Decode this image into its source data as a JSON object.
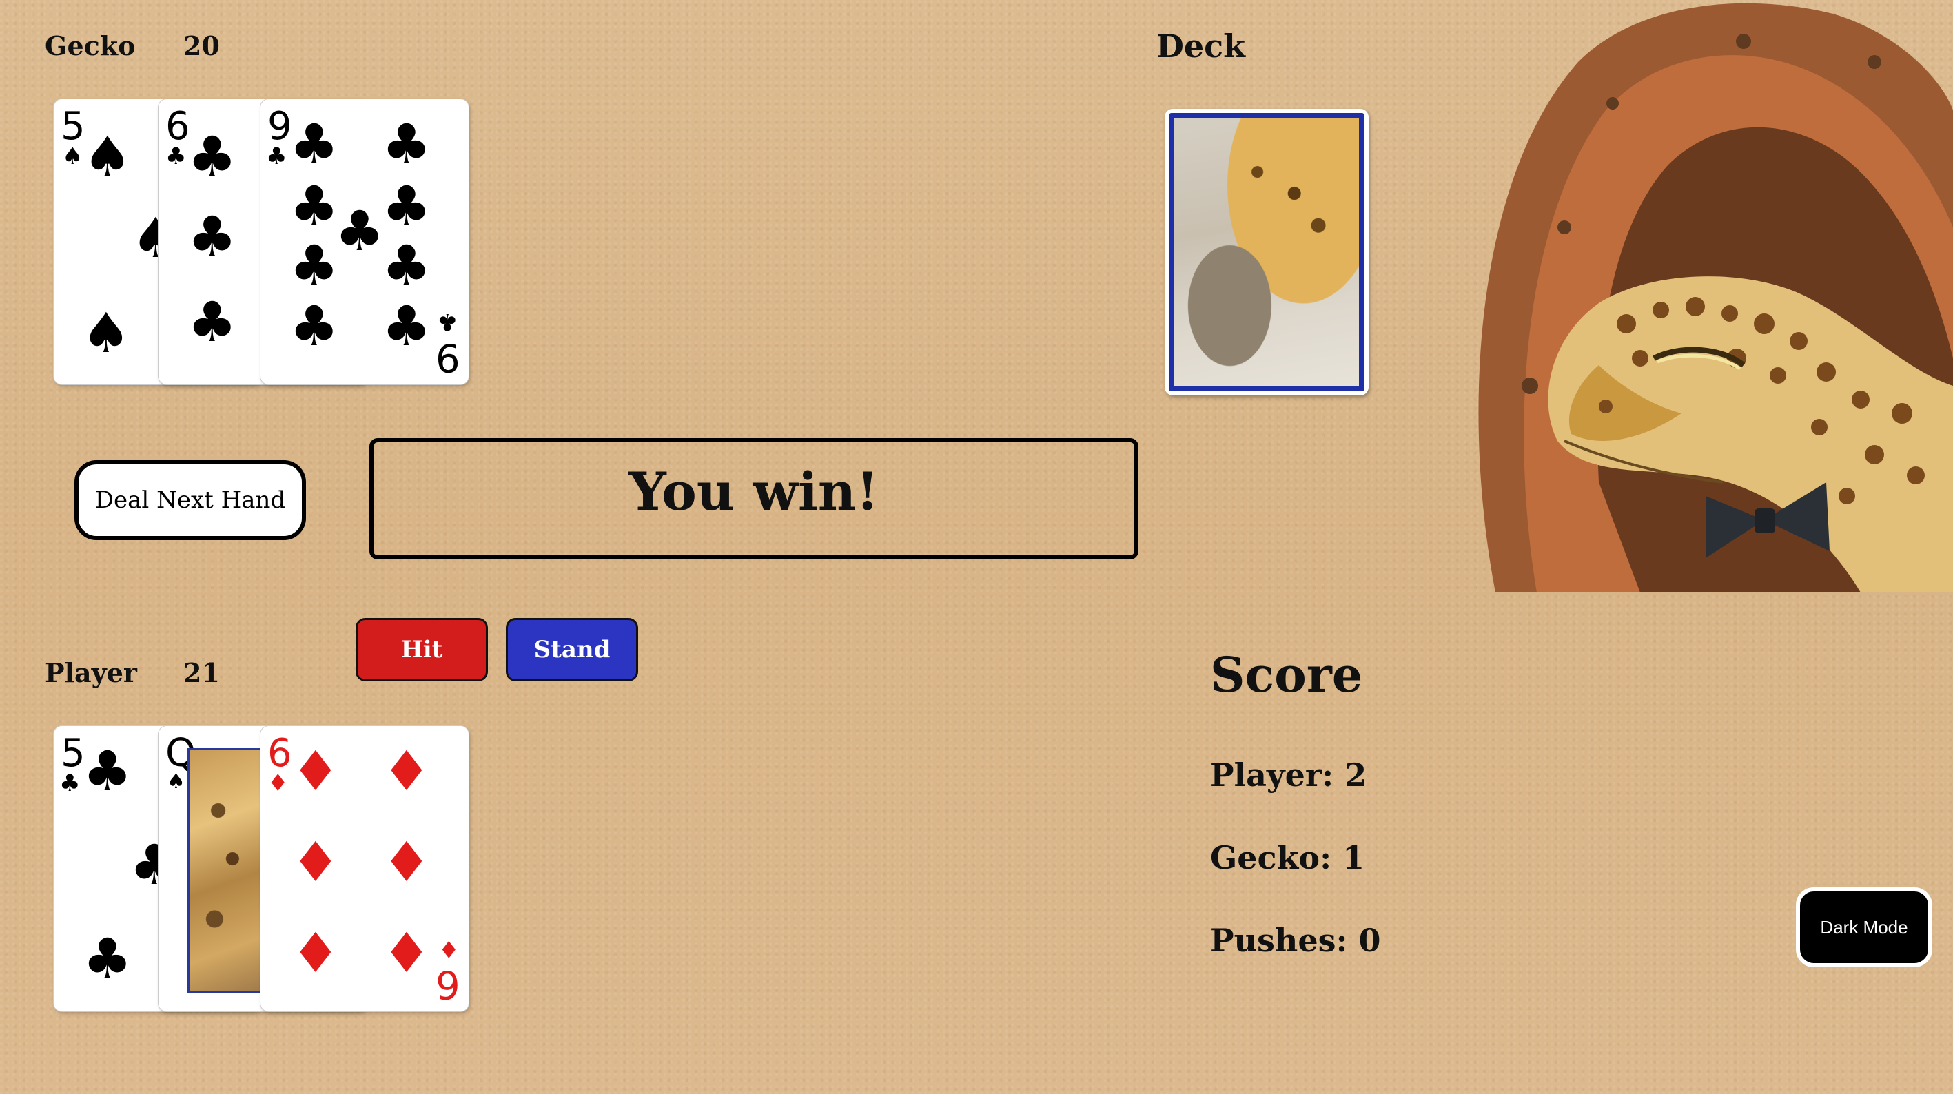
{
  "dealer": {
    "name": "Gecko",
    "score": "20"
  },
  "player": {
    "name": "Player",
    "score": "21"
  },
  "deck": {
    "label": "Deck"
  },
  "controls": {
    "deal_label": "Deal Next Hand",
    "hit_label": "Hit",
    "stand_label": "Stand",
    "dark_mode_label": "Dark Mode"
  },
  "message": "You win!",
  "scoreboard": {
    "title": "Score",
    "player": "Player: 2",
    "gecko": "Gecko: 1",
    "pushes": "Pushes: 0"
  },
  "dealer_cards": [
    {
      "rank": "5",
      "suit": "♠",
      "color": "#000000"
    },
    {
      "rank": "6",
      "suit": "♣",
      "color": "#000000"
    },
    {
      "rank": "9",
      "suit": "♣",
      "color": "#000000"
    }
  ],
  "player_cards": [
    {
      "rank": "5",
      "suit": "♣",
      "color": "#000000"
    },
    {
      "rank": "Q",
      "suit": "♠",
      "color": "#000000"
    },
    {
      "rank": "6",
      "suit": "♦",
      "color": "#e21b1b"
    }
  ],
  "colors": {
    "hit": "#d31c1c",
    "stand": "#2b35c2",
    "deck_border": "#1e2fa8"
  }
}
